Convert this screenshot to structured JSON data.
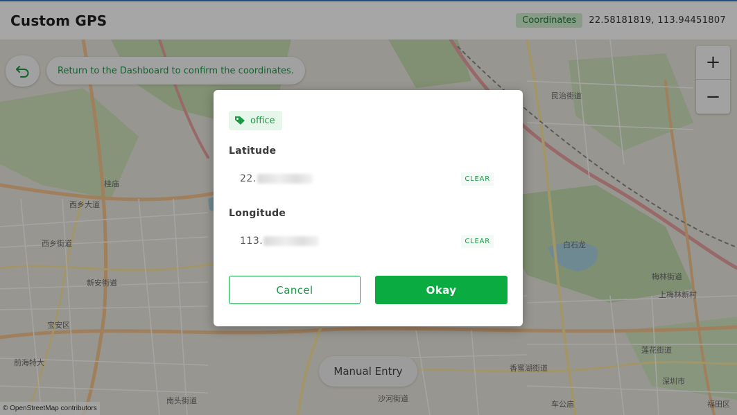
{
  "header": {
    "title": "Custom GPS",
    "coords_badge": "Coordinates",
    "coords_value": "22.58181819, 113.94451807"
  },
  "map": {
    "hint": "Return to the Dashboard to confirm the coordinates.",
    "zoom_in": "+",
    "zoom_out": "−",
    "manual_entry": "Manual Entry",
    "attribution": "© OpenStreetMap contributors",
    "labels": [
      "民治街道",
      "西乡街道",
      "新安街道",
      "宝安区",
      "梅林街道",
      "上梅林新村",
      "香蜜湖街道",
      "深圳市",
      "福田区",
      "沙河街道",
      "南头街道",
      "车公庙",
      "莲花街道",
      "前海特大",
      "西乡大道",
      "桂庙",
      "白石龙"
    ]
  },
  "dialog": {
    "tag": "office",
    "latitude_label": "Latitude",
    "latitude_prefix": "22.",
    "longitude_label": "Longitude",
    "longitude_prefix": "113.",
    "clear_label": "CLEAR",
    "cancel_label": "Cancel",
    "okay_label": "Okay"
  },
  "colors": {
    "accent": "#0aab41",
    "badge_bg": "#cfeecf",
    "tag_bg": "#e7f6ea"
  },
  "icons": {
    "back": "undo-arrow-icon",
    "tag": "tag-icon"
  }
}
